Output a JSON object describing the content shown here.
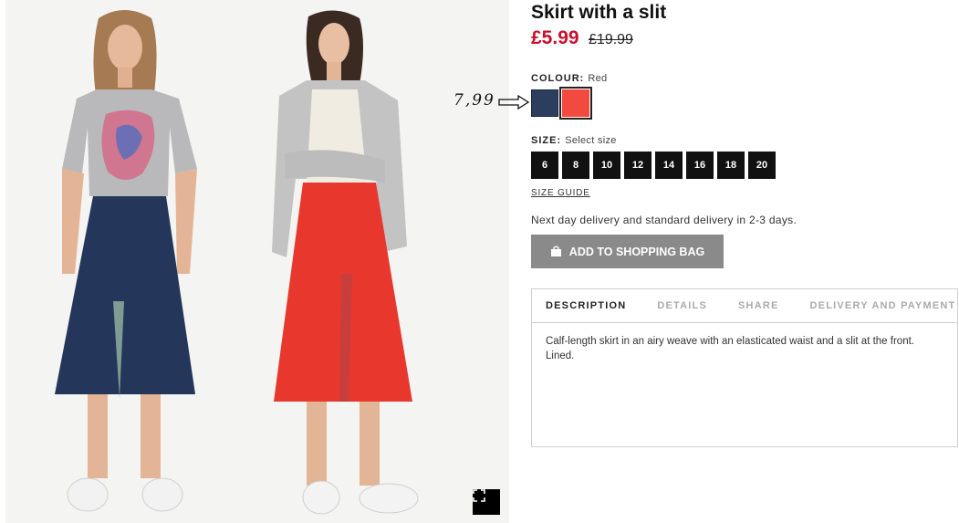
{
  "product": {
    "title": "Skirt with a slit",
    "price_sale": "£5.99",
    "price_old": "£19.99"
  },
  "colour": {
    "label": "COLOUR:",
    "value": "Red",
    "swatches": [
      {
        "name": "Dark blue",
        "hex": "#2c3e5e"
      },
      {
        "name": "Red",
        "hex": "#f24a3e",
        "selected": true
      }
    ]
  },
  "size": {
    "label": "SIZE:",
    "placeholder": "Select size",
    "options": [
      "6",
      "8",
      "10",
      "12",
      "14",
      "16",
      "18",
      "20"
    ],
    "guide_label": "SIZE GUIDE"
  },
  "delivery_note": "Next day delivery and standard delivery in 2-3 days.",
  "add_to_bag_label": "ADD TO SHOPPING BAG",
  "tabs": {
    "items": [
      "DESCRIPTION",
      "DETAILS",
      "SHARE",
      "DELIVERY AND PAYMENT"
    ],
    "active": "DESCRIPTION",
    "content": "Calf-length skirt in an airy weave with an elasticated waist and a slit at the front. Lined."
  },
  "annotation": {
    "text": "7,99",
    "icon": "arrow-right-icon"
  },
  "gallery": {
    "fullscreen_icon": "expand-icon"
  },
  "colors": {
    "sale_red": "#c8102e",
    "button_grey": "#8a8a8a",
    "tab_inactive": "#aaaaaa"
  }
}
